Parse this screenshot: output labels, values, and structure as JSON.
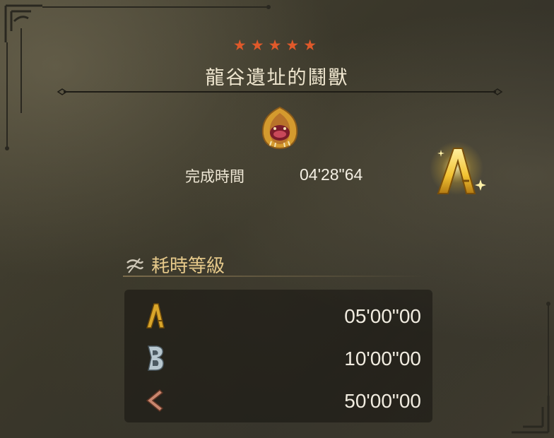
{
  "quest": {
    "stars": "★★★★★",
    "title": "龍谷遺址的鬪獸"
  },
  "result": {
    "time_label": "完成時間",
    "time_value": "04'28\"64",
    "grade": "A"
  },
  "rank_section": {
    "title": "耗時等級",
    "ranks": [
      {
        "grade": "A",
        "time": "05'00\"00",
        "color": "#d9a52a"
      },
      {
        "grade": "B",
        "time": "10'00\"00",
        "color": "#b8c8d0"
      },
      {
        "grade": "C",
        "time": "50'00\"00",
        "color": "#c9866e"
      }
    ]
  },
  "colors": {
    "star": "#e0592a",
    "section_title": "#e6c98a",
    "grade_gold": "#f2c232"
  }
}
